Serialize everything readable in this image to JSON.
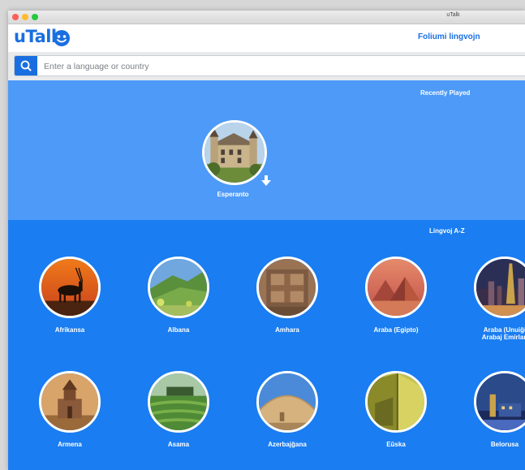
{
  "window": {
    "title": "uTalk"
  },
  "header": {
    "logo_text": "uTalk",
    "browse_link": "Foliumi lingvojn"
  },
  "search": {
    "placeholder": "Enter a language or country"
  },
  "recent": {
    "title": "Recently Played",
    "items": [
      {
        "label": "Esperanto",
        "image": "chateau-photo"
      }
    ]
  },
  "az": {
    "title": "Lingvoj A-Z",
    "languages": [
      {
        "label": "Afrikansa",
        "image": "oryx-sunset-photo"
      },
      {
        "label": "Albana",
        "image": "green-hills-photo"
      },
      {
        "label": "Amhara",
        "image": "rock-church-photo"
      },
      {
        "label": "Araba (Egipto)",
        "image": "pyramids-photo"
      },
      {
        "label": "Araba (Unuiĝintaj Arabaj Emirlandoj)",
        "label_visible": "Araba (Unuiĝi\nArabaj Emirlan",
        "image": "dubai-skyline-photo"
      },
      {
        "label": "Armena",
        "image": "monastery-photo"
      },
      {
        "label": "Asama",
        "image": "tea-garden-photo"
      },
      {
        "label": "Azerbajĝana",
        "image": "dome-photo"
      },
      {
        "label": "Eŭska",
        "image": "modern-building-photo"
      },
      {
        "label": "Belorusa",
        "image": "minsk-night-photo"
      }
    ]
  },
  "colors": {
    "brand_blue": "#1a6fe0",
    "recent_bg": "#4d9af8",
    "az_bg": "#1a7df1"
  }
}
